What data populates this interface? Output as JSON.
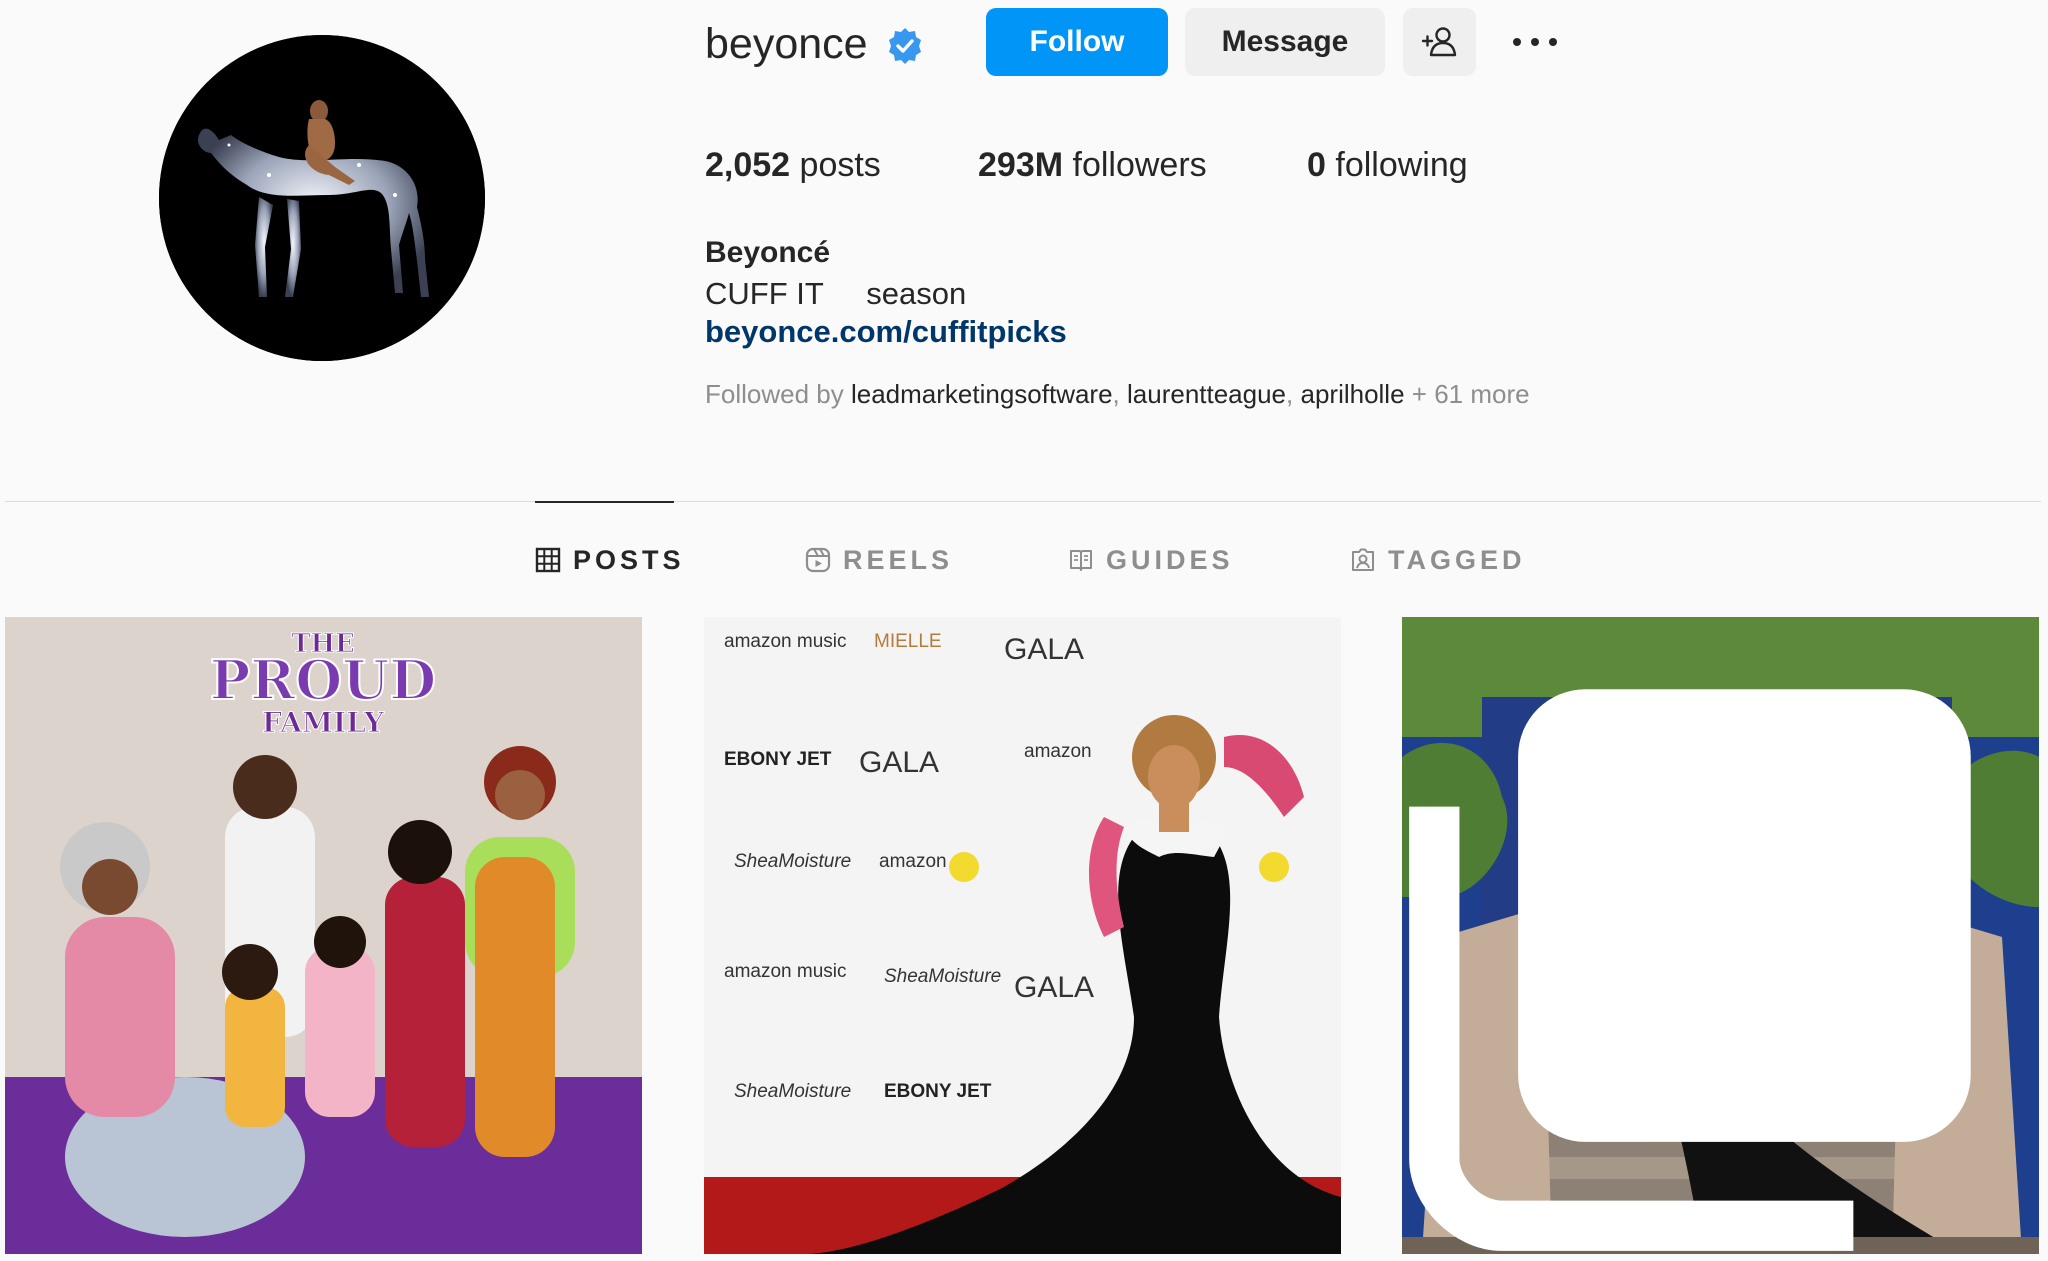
{
  "profile": {
    "username": "beyonce",
    "verified": true,
    "full_name": "Beyoncé",
    "bio": "CUFF IT     season",
    "link": "beyonce.com/cuffitpicks",
    "followed_by_prefix": "Followed by ",
    "followed_by": [
      "leadmarketingsoftware",
      "laurentteague",
      "aprilholle"
    ],
    "followed_by_sep": ", ",
    "followed_by_more": " + 61 more"
  },
  "actions": {
    "follow_label": "Follow",
    "message_label": "Message",
    "suggest_icon": "person-plus-icon",
    "more_icon": "more-horizontal-icon"
  },
  "stats": {
    "posts_count": "2,052",
    "posts_label": " posts",
    "followers_count": "293M",
    "followers_label": " followers",
    "following_count": "0",
    "following_label": " following"
  },
  "tabs": [
    {
      "label": "POSTS",
      "icon": "grid-icon",
      "active": true
    },
    {
      "label": "REELS",
      "icon": "reels-icon",
      "active": false
    },
    {
      "label": "GUIDES",
      "icon": "guides-icon",
      "active": false
    },
    {
      "label": "TAGGED",
      "icon": "tagged-icon",
      "active": false
    }
  ],
  "posts": [
    {
      "caption_text": [
        "THE",
        "PROUD",
        "FAMILY"
      ],
      "multi": false
    },
    {
      "backdrop_text": [
        "amazon music",
        "MIELLE",
        "GALA",
        "EBONY JET",
        "GALA",
        "amazon",
        "SheaMoisture",
        "amazon",
        "amazon music",
        "SheaMoisture",
        "GALA",
        "SheaMoisture",
        "EBONY JET"
      ],
      "multi": false
    },
    {
      "multi": true
    }
  ],
  "colors": {
    "accent": "#0095f6",
    "link": "#00376b",
    "muted": "#8e8e8e",
    "verified": "#3897f0"
  }
}
